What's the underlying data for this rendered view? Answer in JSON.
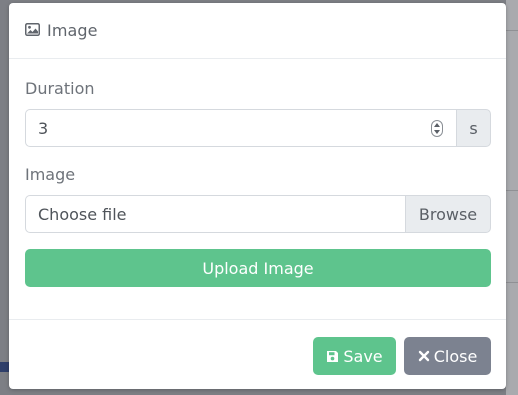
{
  "modal": {
    "title": "Image",
    "title_icon": "image-icon",
    "duration": {
      "label": "Duration",
      "value": "3",
      "unit": "s"
    },
    "image": {
      "label": "Image",
      "file_placeholder": "Choose file",
      "browse_label": "Browse"
    },
    "upload_label": "Upload Image",
    "footer": {
      "save_label": "Save",
      "save_icon": "floppy-disk-icon",
      "close_label": "Close",
      "close_icon": "close-icon"
    }
  },
  "colors": {
    "success": "#5ec48d",
    "secondary": "#7c8290",
    "overlay": "#7d7f85"
  }
}
